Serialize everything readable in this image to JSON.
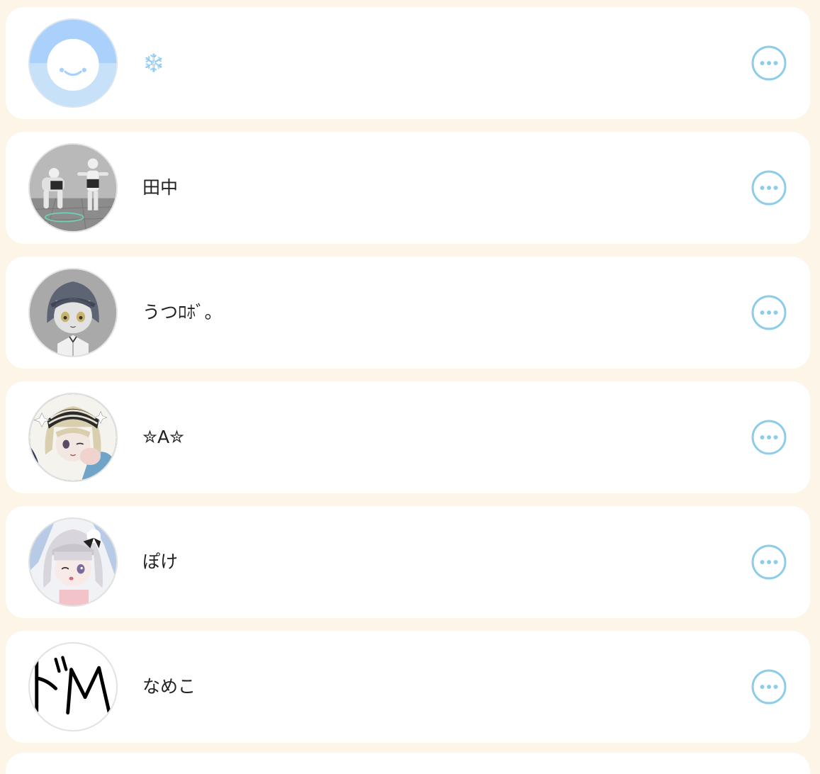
{
  "theme": {
    "background": "#fdf6e8",
    "card_background": "#ffffff",
    "accent": "#8ecdea"
  },
  "users": [
    {
      "name": "❄️",
      "avatar": "default-smiley-avatar",
      "menu_icon": "more-options-icon"
    },
    {
      "name": "田中",
      "avatar": "3d-figures-photo-avatar",
      "menu_icon": "more-options-icon"
    },
    {
      "name": "うつﾛﾎﾞ。",
      "avatar": "sketch-girl-avatar",
      "menu_icon": "more-options-icon"
    },
    {
      "name": "✮A✮",
      "avatar": "anime-girl-headband-avatar",
      "menu_icon": "more-options-icon"
    },
    {
      "name": "ぽけ",
      "avatar": "anime-girl-white-hair-avatar",
      "menu_icon": "more-options-icon"
    },
    {
      "name": "なめこ",
      "avatar": "handwritten-doM-avatar",
      "avatar_text": "ﾄﾞM",
      "menu_icon": "more-options-icon"
    }
  ]
}
